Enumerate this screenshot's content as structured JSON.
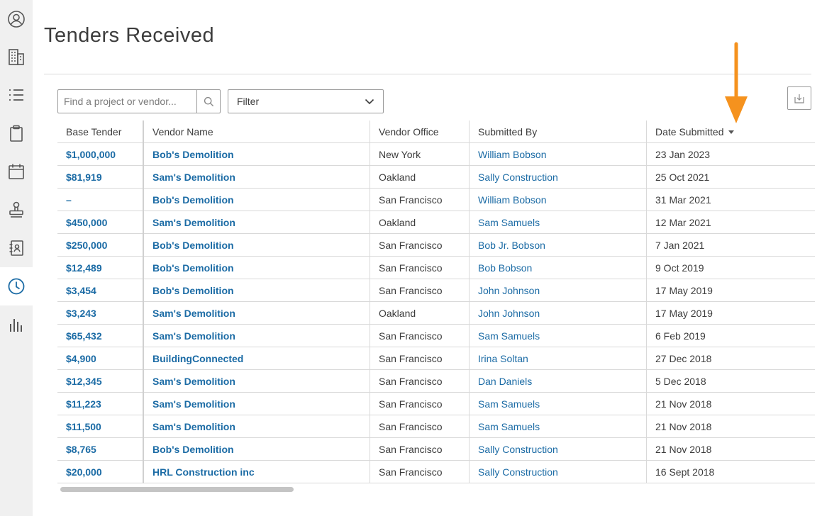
{
  "sidebar": {
    "items": [
      {
        "icon": "user-icon"
      },
      {
        "icon": "building-icon"
      },
      {
        "icon": "list-icon"
      },
      {
        "icon": "clipboard-icon"
      },
      {
        "icon": "calendar-icon"
      },
      {
        "icon": "stamp-icon"
      },
      {
        "icon": "address-book-icon"
      },
      {
        "icon": "clock-icon",
        "active": true
      },
      {
        "icon": "bar-chart-icon"
      }
    ],
    "active_color": "#1b6ba5"
  },
  "page": {
    "title": "Tenders Received"
  },
  "toolbar": {
    "search_placeholder": "Find a project or vendor...",
    "filter_label": "Filter"
  },
  "table": {
    "headers": {
      "base_tender": "Base Tender",
      "vendor_name": "Vendor Name",
      "vendor_office": "Vendor Office",
      "submitted_by": "Submitted By",
      "date_submitted": "Date Submitted"
    },
    "rows": [
      {
        "base_tender": "$1,000,000",
        "vendor_name": "Bob's Demolition",
        "vendor_office": "New York",
        "submitted_by": "William Bobson",
        "date_submitted": "23 Jan 2023"
      },
      {
        "base_tender": "$81,919",
        "vendor_name": "Sam's Demolition",
        "vendor_office": "Oakland",
        "submitted_by": "Sally Construction",
        "date_submitted": "25 Oct 2021"
      },
      {
        "base_tender": "–",
        "vendor_name": "Bob's Demolition",
        "vendor_office": "San Francisco",
        "submitted_by": "William Bobson",
        "date_submitted": "31 Mar 2021"
      },
      {
        "base_tender": "$450,000",
        "vendor_name": "Sam's Demolition",
        "vendor_office": "Oakland",
        "submitted_by": "Sam Samuels",
        "date_submitted": "12 Mar 2021"
      },
      {
        "base_tender": "$250,000",
        "vendor_name": "Bob's Demolition",
        "vendor_office": "San Francisco",
        "submitted_by": "Bob Jr. Bobson",
        "date_submitted": "7 Jan 2021"
      },
      {
        "base_tender": "$12,489",
        "vendor_name": "Bob's Demolition",
        "vendor_office": "San Francisco",
        "submitted_by": "Bob Bobson",
        "date_submitted": "9 Oct 2019"
      },
      {
        "base_tender": "$3,454",
        "vendor_name": "Bob's Demolition",
        "vendor_office": "San Francisco",
        "submitted_by": "John Johnson",
        "date_submitted": "17 May 2019"
      },
      {
        "base_tender": "$3,243",
        "vendor_name": "Sam's Demolition",
        "vendor_office": "Oakland",
        "submitted_by": "John Johnson",
        "date_submitted": "17 May 2019"
      },
      {
        "base_tender": "$65,432",
        "vendor_name": "Sam's Demolition",
        "vendor_office": "San Francisco",
        "submitted_by": "Sam Samuels",
        "date_submitted": "6 Feb 2019"
      },
      {
        "base_tender": "$4,900",
        "vendor_name": "BuildingConnected",
        "vendor_office": "San Francisco",
        "submitted_by": "Irina Soltan",
        "date_submitted": "27 Dec 2018"
      },
      {
        "base_tender": "$12,345",
        "vendor_name": "Sam's Demolition",
        "vendor_office": "San Francisco",
        "submitted_by": "Dan Daniels",
        "date_submitted": "5 Dec 2018"
      },
      {
        "base_tender": "$11,223",
        "vendor_name": "Sam's Demolition",
        "vendor_office": "San Francisco",
        "submitted_by": "Sam Samuels",
        "date_submitted": "21 Nov 2018"
      },
      {
        "base_tender": "$11,500",
        "vendor_name": "Sam's Demolition",
        "vendor_office": "San Francisco",
        "submitted_by": "Sam Samuels",
        "date_submitted": "21 Nov 2018"
      },
      {
        "base_tender": "$8,765",
        "vendor_name": "Bob's Demolition",
        "vendor_office": "San Francisco",
        "submitted_by": "Sally Construction",
        "date_submitted": "21 Nov 2018"
      },
      {
        "base_tender": "$20,000",
        "vendor_name": "HRL Construction inc",
        "vendor_office": "San Francisco",
        "submitted_by": "Sally Construction",
        "date_submitted": "16 Sept 2018"
      }
    ],
    "sort_column": "date_submitted",
    "sort_direction": "descending"
  },
  "annotation": {
    "arrow_color": "#f5921e"
  },
  "colors": {
    "link": "#1b6ba5",
    "border": "#d9d9d9"
  }
}
